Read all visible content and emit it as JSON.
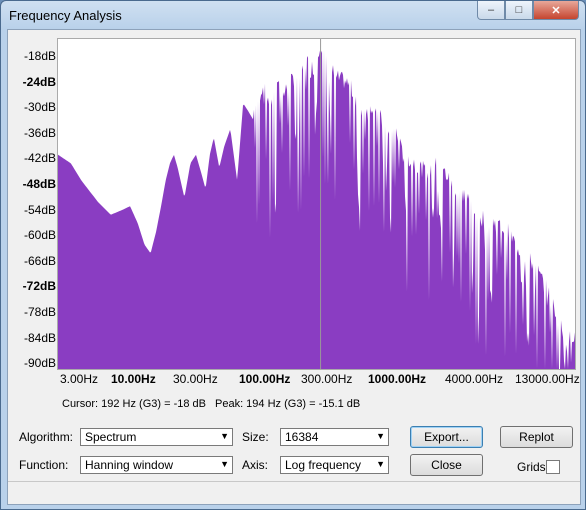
{
  "window": {
    "title": "Frequency Analysis"
  },
  "titlebar_buttons": {
    "minimize": "–",
    "maximize": "□",
    "close": "✕"
  },
  "y_axis_labels": [
    {
      "text": "-18dB",
      "bold": false
    },
    {
      "text": "-24dB",
      "bold": true
    },
    {
      "text": "-30dB",
      "bold": false
    },
    {
      "text": "-36dB",
      "bold": false
    },
    {
      "text": "-42dB",
      "bold": false
    },
    {
      "text": "-48dB",
      "bold": true
    },
    {
      "text": "-54dB",
      "bold": false
    },
    {
      "text": "-60dB",
      "bold": false
    },
    {
      "text": "-66dB",
      "bold": false
    },
    {
      "text": "-72dB",
      "bold": true
    },
    {
      "text": "-78dB",
      "bold": false
    },
    {
      "text": "-84dB",
      "bold": false
    },
    {
      "text": "-90dB",
      "bold": false
    }
  ],
  "x_axis_labels": [
    {
      "text": "3.00Hz",
      "bold": false
    },
    {
      "text": "10.00Hz",
      "bold": true
    },
    {
      "text": "30.00Hz",
      "bold": false
    },
    {
      "text": "100.00Hz",
      "bold": true
    },
    {
      "text": "300.00Hz",
      "bold": false
    },
    {
      "text": "1000.00Hz",
      "bold": true
    },
    {
      "text": "4000.00Hz",
      "bold": false
    },
    {
      "text": "13000.00Hz",
      "bold": false
    }
  ],
  "chart_data": {
    "type": "area",
    "xscale": "log",
    "xlim": [
      2,
      16000
    ],
    "ylim": [
      -92,
      -15
    ],
    "fill_color": "#8a3dc2",
    "cursor_x": 192,
    "x": [
      2,
      2.5,
      3,
      4,
      5,
      6,
      7,
      8,
      9,
      10,
      11,
      12,
      13,
      14,
      15,
      16,
      18,
      20,
      22,
      24,
      26,
      28,
      30,
      33,
      36,
      40,
      45,
      50,
      55,
      60,
      70,
      80,
      90,
      100,
      110,
      120,
      130,
      150,
      170,
      190,
      200,
      250,
      300,
      350,
      400,
      500,
      600,
      700,
      800,
      1000,
      1200,
      1500,
      2000,
      2500,
      3000,
      4000,
      5000,
      6000,
      8000,
      10000,
      12000,
      13000,
      14000,
      15000,
      16000
    ],
    "y": [
      -42,
      -44,
      -48,
      -53,
      -56,
      -55,
      -54,
      -58,
      -63,
      -65,
      -60,
      -54,
      -48,
      -44,
      -42,
      -45,
      -52,
      -44,
      -42,
      -46,
      -50,
      -42,
      -38,
      -45,
      -40,
      -36,
      -48,
      -30,
      -32,
      -34,
      -28,
      -32,
      -26,
      -30,
      -28,
      -26,
      -27,
      -22,
      -24,
      -18,
      -20,
      -26,
      -27,
      -30,
      -34,
      -32,
      -40,
      -38,
      -44,
      -46,
      -48,
      -46,
      -52,
      -54,
      -58,
      -60,
      -62,
      -66,
      -70,
      -76,
      -82,
      -86,
      -88,
      -86,
      -86
    ]
  },
  "cursor_info": "Cursor: 192 Hz (G3) = -18 dB",
  "peak_info": "Peak: 194 Hz (G3) = -15.1 dB",
  "controls": {
    "algorithm_label": "Algorithm:",
    "algorithm_value": "Spectrum",
    "size_label": "Size:",
    "size_value": "16384",
    "function_label": "Function:",
    "function_value": "Hanning window",
    "axis_label": "Axis:",
    "axis_value": "Log frequency",
    "export_button": "Export...",
    "replot_button": "Replot",
    "close_button": "Close",
    "grids_label": "Grids"
  }
}
